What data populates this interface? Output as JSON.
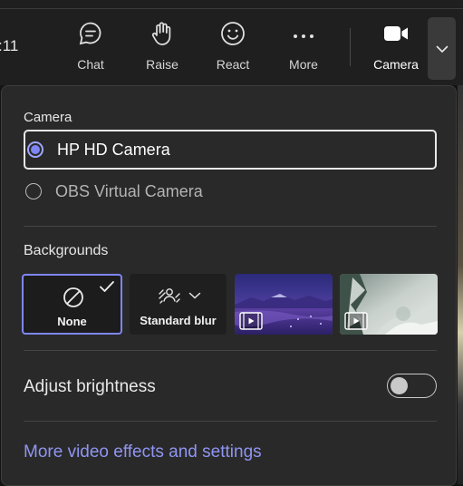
{
  "toolbar": {
    "timer": ":11",
    "buttons": [
      {
        "label": "Chat",
        "icon": "chat-icon"
      },
      {
        "label": "Raise",
        "icon": "hand-icon"
      },
      {
        "label": "React",
        "icon": "smiley-icon"
      },
      {
        "label": "More",
        "icon": "more-dots-icon"
      },
      {
        "label": "Camera",
        "icon": "video-camera-icon"
      }
    ],
    "dropdown_icon": "chevron-down-icon"
  },
  "panel": {
    "camera_section_label": "Camera",
    "cameras": [
      {
        "name": "HP HD Camera",
        "selected": true
      },
      {
        "name": "OBS Virtual Camera",
        "selected": false
      }
    ],
    "backgrounds_label": "Backgrounds",
    "backgrounds": [
      {
        "label": "None",
        "icon": "none-icon",
        "selected": true
      },
      {
        "label": "Standard blur",
        "icon": "blur-icon",
        "selected": false
      },
      {
        "label": "",
        "icon": "video-play-icon",
        "kind": "purple-lake-video"
      },
      {
        "label": "",
        "icon": "video-play-icon",
        "kind": "snowy-trees-video"
      }
    ],
    "brightness_label": "Adjust brightness",
    "brightness_on": false,
    "more_link": "More video effects and settings"
  },
  "colors": {
    "accent": "#7f85f5",
    "link": "#8f95f2",
    "panel_bg": "#292929"
  }
}
